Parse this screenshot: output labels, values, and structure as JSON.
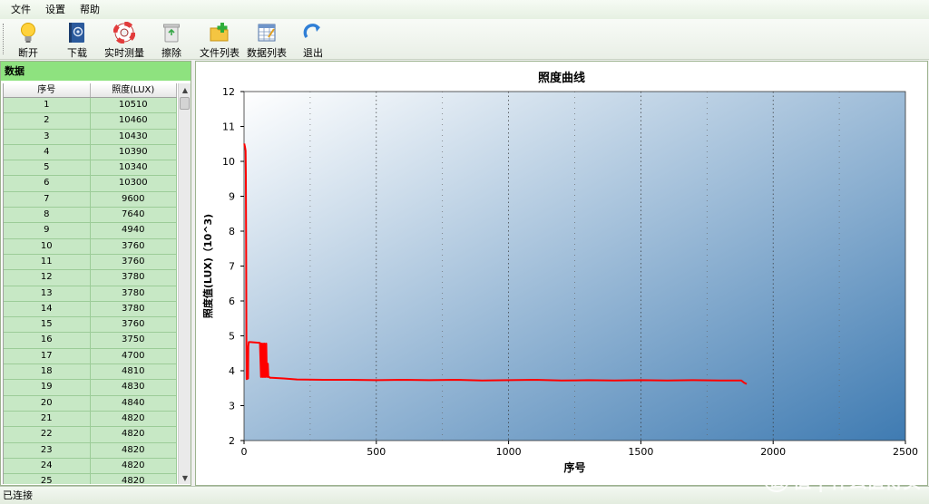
{
  "menu": [
    "文件",
    "设置",
    "帮助"
  ],
  "toolbar": [
    {
      "label": "断开",
      "icon": "lightbulb-icon"
    },
    {
      "label": "下载",
      "icon": "address-book-icon"
    },
    {
      "label": "实时测量",
      "icon": "lifebuoy-icon"
    },
    {
      "label": "擦除",
      "icon": "recycle-bin-icon"
    },
    {
      "label": "文件列表",
      "icon": "folder-add-icon"
    },
    {
      "label": "数据列表",
      "icon": "spreadsheet-icon"
    },
    {
      "label": "退出",
      "icon": "exit-arrow-icon"
    }
  ],
  "data_panel": {
    "title": "数据",
    "columns": [
      "序号",
      "照度(LUX)"
    ],
    "rows": [
      [
        "1",
        "10510"
      ],
      [
        "2",
        "10460"
      ],
      [
        "3",
        "10430"
      ],
      [
        "4",
        "10390"
      ],
      [
        "5",
        "10340"
      ],
      [
        "6",
        "10300"
      ],
      [
        "7",
        "9600"
      ],
      [
        "8",
        "7640"
      ],
      [
        "9",
        "4940"
      ],
      [
        "10",
        "3760"
      ],
      [
        "11",
        "3760"
      ],
      [
        "12",
        "3780"
      ],
      [
        "13",
        "3780"
      ],
      [
        "14",
        "3780"
      ],
      [
        "15",
        "3760"
      ],
      [
        "16",
        "3750"
      ],
      [
        "17",
        "4700"
      ],
      [
        "18",
        "4810"
      ],
      [
        "19",
        "4830"
      ],
      [
        "20",
        "4840"
      ],
      [
        "21",
        "4820"
      ],
      [
        "22",
        "4820"
      ],
      [
        "23",
        "4820"
      ],
      [
        "24",
        "4820"
      ],
      [
        "25",
        "4820"
      ]
    ]
  },
  "chart_data": {
    "type": "line",
    "title": "照度曲线",
    "xlabel": "序号",
    "ylabel": "照度值(LUX)（10^3)",
    "xlim": [
      0,
      2500
    ],
    "ylim": [
      2,
      12
    ],
    "xticks": [
      "0",
      "500",
      "1000",
      "1500",
      "2000",
      "2500"
    ],
    "yticks": [
      "2",
      "3",
      "4",
      "5",
      "6",
      "7",
      "8",
      "9",
      "10",
      "11",
      "12"
    ],
    "grid": true,
    "colors": {
      "line": "#ff0000",
      "bg_start": "#ffffff",
      "bg_end": "#3f7bb2"
    },
    "series": [
      {
        "x": [
          1,
          2,
          3,
          4,
          5,
          6,
          7,
          8,
          9,
          10,
          15,
          16,
          18,
          25,
          60,
          64,
          66,
          70,
          72,
          75,
          78,
          80,
          84,
          86,
          90,
          92,
          95,
          98,
          100,
          105,
          150,
          200,
          300,
          400,
          500,
          600,
          700,
          800,
          900,
          1000,
          1100,
          1200,
          1300,
          1400,
          1500,
          1600,
          1700,
          1800,
          1880,
          1890,
          1900
        ],
        "y": [
          10.51,
          10.46,
          10.43,
          10.39,
          10.34,
          10.3,
          9.6,
          7.64,
          4.94,
          3.76,
          3.78,
          4.7,
          4.82,
          4.82,
          4.8,
          3.82,
          4.78,
          3.82,
          4.78,
          3.82,
          4.78,
          3.82,
          4.78,
          3.82,
          4.2,
          3.82,
          3.82,
          3.8,
          3.8,
          3.8,
          3.78,
          3.75,
          3.74,
          3.74,
          3.73,
          3.74,
          3.73,
          3.74,
          3.72,
          3.73,
          3.74,
          3.72,
          3.73,
          3.72,
          3.73,
          3.72,
          3.73,
          3.72,
          3.72,
          3.66,
          3.62
        ]
      }
    ]
  },
  "status": "已连接",
  "watermark": "值 | 什么值得买"
}
